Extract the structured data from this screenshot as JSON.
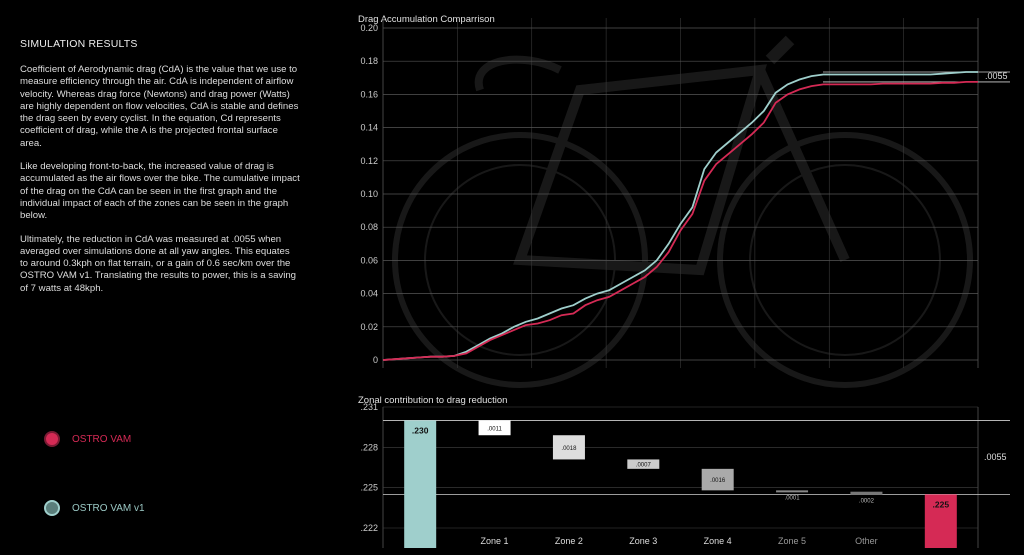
{
  "left_panel": {
    "heading": "SIMULATION RESULTS",
    "paragraphs": [
      "Coefficient of Aerodynamic drag (CdA) is the value that we use to measure efficiency through the air. CdA is independent of airflow velocity. Whereas drag force (Newtons) and drag power (Watts) are highly dependent on flow velocities, CdA is stable and defines the drag seen by every cyclist. In the equation, Cd represents coefficient of drag, while the A is the projected frontal surface area.",
      "Like developing front-to-back, the increased value of drag is accumulated as the air flows over the bike. The cumulative impact of the drag on the CdA can be seen in the first graph and the individual impact of each of the zones can be seen in the graph below.",
      "Ultimately, the reduction in CdA was measured at .0055 when averaged over simulations done at all yaw angles. This equates to around 0.3kph on flat terrain, or a gain of 0.6 sec/km over the OSTRO VAM v1. Translating the results to power, this is a saving of 7 watts at 48kph."
    ]
  },
  "legend": [
    {
      "label": "OSTRO VAM",
      "color": "#d52a55"
    },
    {
      "label": "OSTRO VAM v1",
      "color": "#9fcfcc"
    }
  ],
  "chart_data": [
    {
      "type": "line",
      "title": "Drag Accumulation Comparrison",
      "xlabel": "",
      "ylabel": "",
      "ylim": [
        0,
        0.2
      ],
      "yticks": [
        0,
        0.02,
        0.04,
        0.06,
        0.08,
        0.1,
        0.12,
        0.14,
        0.16,
        0.18,
        0.2
      ],
      "ytick_labels": [
        "0",
        "0.02",
        "0.04",
        "0.06",
        "0.08",
        "0.10",
        "0.12",
        "0.14",
        "0.16",
        "0.18",
        "0.20"
      ],
      "grid": true,
      "annotation": ".0055",
      "series": [
        {
          "name": "OSTRO VAM",
          "color": "#d52a55",
          "x": [
            0,
            2,
            4,
            6,
            8,
            10,
            12,
            14,
            16,
            18,
            20,
            22,
            24,
            26,
            28,
            30,
            32,
            34,
            36,
            38,
            40,
            42,
            44,
            46,
            48,
            50,
            52,
            54,
            56,
            58,
            60,
            62,
            64,
            66,
            68,
            70,
            72,
            74,
            76,
            78,
            80,
            82,
            84,
            86,
            88,
            90,
            92,
            94,
            96,
            98,
            100
          ],
          "values": [
            0,
            0.0005,
            0.001,
            0.0015,
            0.002,
            0.002,
            0.0025,
            0.004,
            0.008,
            0.012,
            0.015,
            0.018,
            0.021,
            0.022,
            0.024,
            0.027,
            0.028,
            0.033,
            0.036,
            0.038,
            0.042,
            0.046,
            0.05,
            0.056,
            0.065,
            0.078,
            0.088,
            0.108,
            0.118,
            0.124,
            0.13,
            0.136,
            0.143,
            0.155,
            0.16,
            0.163,
            0.165,
            0.166,
            0.166,
            0.166,
            0.166,
            0.166,
            0.1665,
            0.1665,
            0.1665,
            0.1665,
            0.1665,
            0.167,
            0.167,
            0.1675,
            0.1675
          ]
        },
        {
          "name": "OSTRO VAM v1",
          "color": "#9fcfcc",
          "x": [
            0,
            2,
            4,
            6,
            8,
            10,
            12,
            14,
            16,
            18,
            20,
            22,
            24,
            26,
            28,
            30,
            32,
            34,
            36,
            38,
            40,
            42,
            44,
            46,
            48,
            50,
            52,
            54,
            56,
            58,
            60,
            62,
            64,
            66,
            68,
            70,
            72,
            74,
            76,
            78,
            80,
            82,
            84,
            86,
            88,
            90,
            92,
            94,
            96,
            98,
            100
          ],
          "values": [
            0,
            0.0005,
            0.001,
            0.0015,
            0.002,
            0.002,
            0.0025,
            0.005,
            0.009,
            0.013,
            0.016,
            0.02,
            0.023,
            0.025,
            0.028,
            0.031,
            0.033,
            0.037,
            0.04,
            0.042,
            0.046,
            0.05,
            0.054,
            0.06,
            0.07,
            0.082,
            0.092,
            0.115,
            0.125,
            0.131,
            0.137,
            0.143,
            0.15,
            0.161,
            0.166,
            0.169,
            0.171,
            0.172,
            0.172,
            0.172,
            0.172,
            0.172,
            0.172,
            0.172,
            0.172,
            0.172,
            0.172,
            0.1725,
            0.173,
            0.1735,
            0.1735
          ]
        }
      ]
    },
    {
      "type": "bar",
      "title": "Zonal contribution to drag reduction",
      "ylim": [
        0.222,
        0.231
      ],
      "yticks": [
        0.222,
        0.225,
        0.228,
        0.231
      ],
      "ytick_labels": [
        ".222",
        ".225",
        ".228",
        ".231"
      ],
      "annotation": ".0055",
      "categories": [
        "",
        "Zone 1",
        "Zone 2",
        "Zone 3",
        "Zone 4",
        "Zone 5",
        "Other",
        ""
      ],
      "bars": [
        {
          "category": "",
          "label": ".230",
          "base": 0.222,
          "top": 0.23,
          "color": "#9fcfcc"
        },
        {
          "category": "Zone 1",
          "label": ".0011",
          "base": 0.2289,
          "top": 0.23,
          "color": "#ffffff"
        },
        {
          "category": "Zone 2",
          "label": ".0018",
          "base": 0.2271,
          "top": 0.2289,
          "color": "#dddddd"
        },
        {
          "category": "Zone 3",
          "label": ".0007",
          "base": 0.2264,
          "top": 0.2271,
          "color": "#cccccc"
        },
        {
          "category": "Zone 4",
          "label": ".0016",
          "base": 0.2248,
          "top": 0.2264,
          "color": "#aaaaaa"
        },
        {
          "category": "Zone 5",
          "label": ".0001",
          "base": 0.2247,
          "top": 0.2248,
          "color": "#888888"
        },
        {
          "category": "Other",
          "label": ".0002",
          "base": 0.2245,
          "top": 0.2247,
          "color": "#777777"
        },
        {
          "category": "",
          "label": ".225",
          "base": 0.222,
          "top": 0.2245,
          "color": "#d52a55"
        }
      ]
    }
  ]
}
